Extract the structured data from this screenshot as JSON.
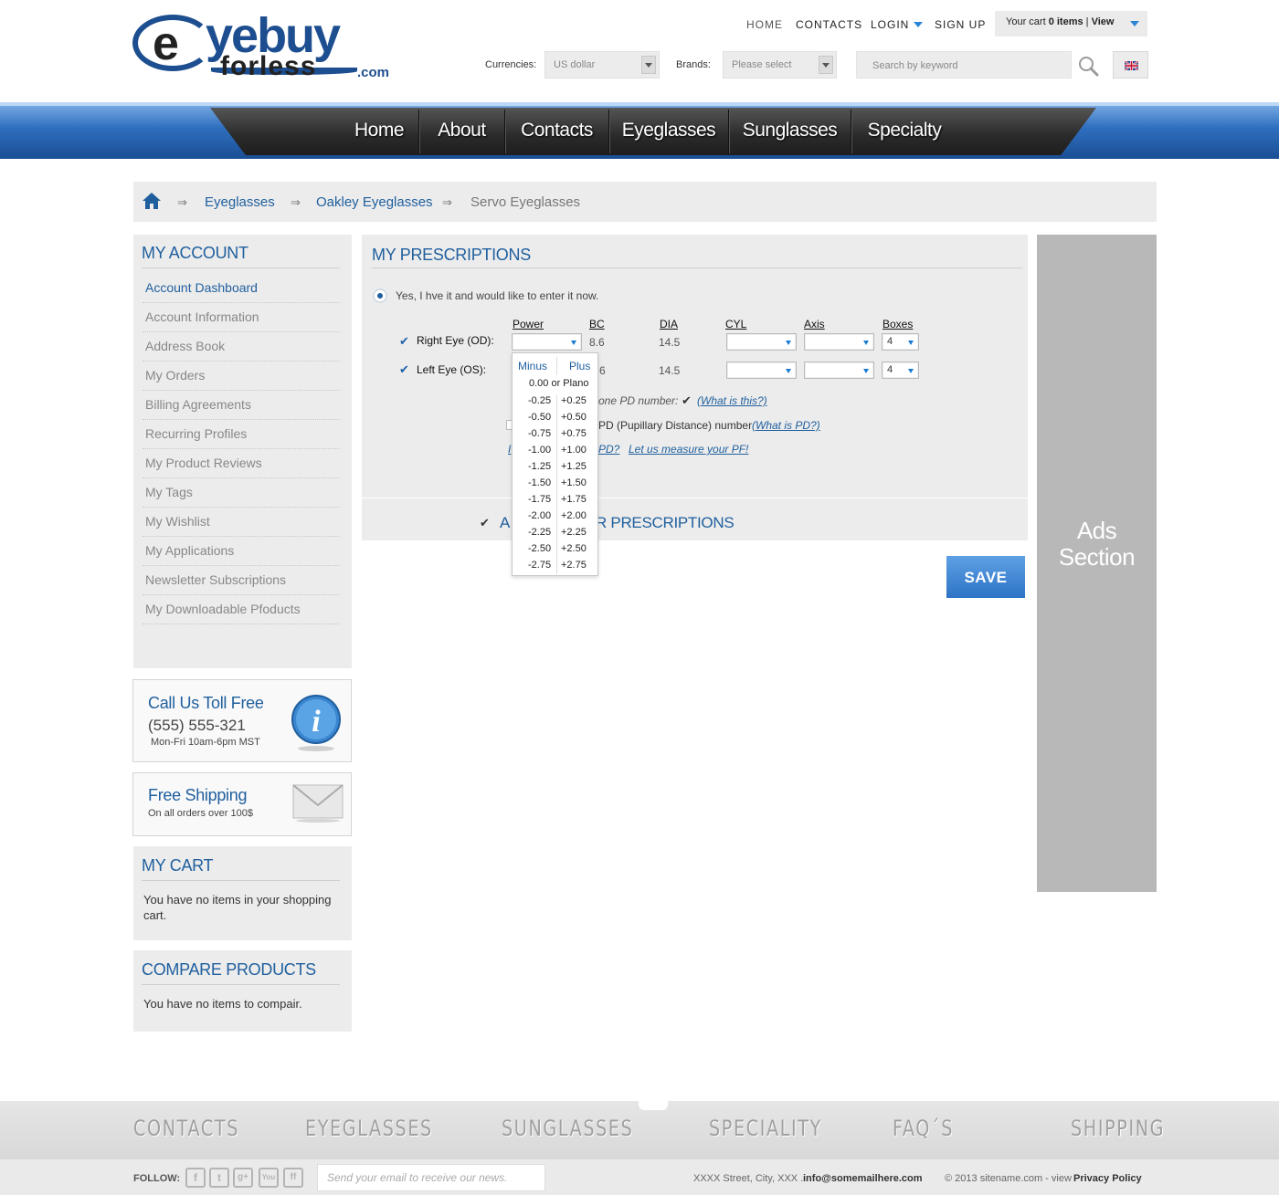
{
  "logo": {
    "e": "e",
    "eyebuy": "yebuy",
    "forless": "forless",
    "com": ".com"
  },
  "topnav": {
    "home": "HOME",
    "contacts": "CONTACTS",
    "login": "LOGIN",
    "signup": "SIGN UP"
  },
  "cart": {
    "prefix": "Your cart",
    "count": "0 items",
    "sep": " | ",
    "view": "View"
  },
  "filters": {
    "currencies_label": "Currencies:",
    "currency_value": "US dollar",
    "brands_label": "Brands:",
    "brands_value": "Please select",
    "search_placeholder": "Search by keyword"
  },
  "mainnav": [
    "Home",
    "About",
    "Contacts",
    "Eyeglasses",
    "Sunglasses",
    "Specialty"
  ],
  "breadcrumb": {
    "sep": "⇒",
    "items": [
      "Eyeglasses",
      "Oakley Eyeglasses",
      "Servo Eyeglasses"
    ]
  },
  "account": {
    "title": "MY ACCOUNT",
    "items": [
      "Account Dashboard",
      "Account Information",
      "Address Book",
      "My Orders",
      "Billing Agreements",
      "Recurring Profiles",
      "My Product Reviews",
      "My Tags",
      "My Wishlist",
      "My Applications",
      "Newsletter Subscriptions",
      "My Downloadable Pfoducts"
    ]
  },
  "callus": {
    "title": "Call Us Toll Free",
    "phone": "(555) 555-321",
    "hours": "Mon-Fri 10am-6pm MST"
  },
  "shipping": {
    "title": "Free Shipping",
    "text": "On all orders over 100$"
  },
  "mycart": {
    "title": "MY CART",
    "text": "You have no items in your shopping cart."
  },
  "compare": {
    "title": "COMPARE PRODUCTS",
    "text": "You have no items to compair."
  },
  "prescriptions": {
    "title": "MY PRESCRIPTIONS",
    "radio_label": "Yes, I hve it and would like to enter it now.",
    "headers": {
      "power": "Power",
      "bc": "BC",
      "dia": "DIA",
      "cyl": "CYL",
      "axis": "Axis",
      "boxes": "Boxes"
    },
    "right": {
      "label": "Right Eye (OD):",
      "bc": "8.6",
      "dia": "14.5",
      "boxes": "4"
    },
    "left": {
      "label": "Left Eye (OS):",
      "bc": "6",
      "dia": "14.5",
      "boxes": "4"
    },
    "pd_one": "one PD number:",
    "what_is_this": "(What is this?)",
    "pd_two": "PD (Pupillary Distance) number",
    "what_is_pd": "(What is PD?)",
    "measure_pd": "PD?",
    "let_us": "Let us measure your PF!",
    "other_fragment_a": "A",
    "other_fragment_b": "R PRESCRIPTIONS",
    "save": "SAVE"
  },
  "power_dropdown": {
    "minus_header": "Minus",
    "plus_header": "Plus",
    "plano": "0.00 or Plano",
    "minus": [
      "-0.25",
      "-0.50",
      "-0.75",
      "-1.00",
      "-1.25",
      "-1.50",
      "-1.75",
      "-2.00",
      "-2.25",
      "-2.50",
      "-2.75"
    ],
    "plus": [
      "+0.25",
      "+0.50",
      "+0.75",
      "+1.00",
      "+1.25",
      "+1.50",
      "+1.75",
      "+2.00",
      "+2.25",
      "+2.50",
      "+2.75"
    ]
  },
  "ads": {
    "line1": "Ads",
    "line2": "Section"
  },
  "footer": {
    "links": [
      "CONTACTS",
      "EYEGLASSES",
      "SUNGLASSES",
      "SPECIALITY",
      "FAQ´S",
      "SHIPPING"
    ],
    "follow": "FOLLOW:",
    "social": [
      "f",
      "t",
      "g+",
      "You",
      "ff"
    ],
    "newsletter_placeholder": "Send your email to receive our news.",
    "address": "XXXX Street, City, XXX .",
    "email": "info@somemailhere.com",
    "copyright": "© 2013 sitename.com - view",
    "privacy": "Privacy Policy"
  },
  "colors": {
    "brand_blue": "#1f5f9e",
    "accent_blue": "#2a86d4",
    "nav_dark": "#2a2a2a",
    "ads_gray": "#b8b8b8"
  }
}
